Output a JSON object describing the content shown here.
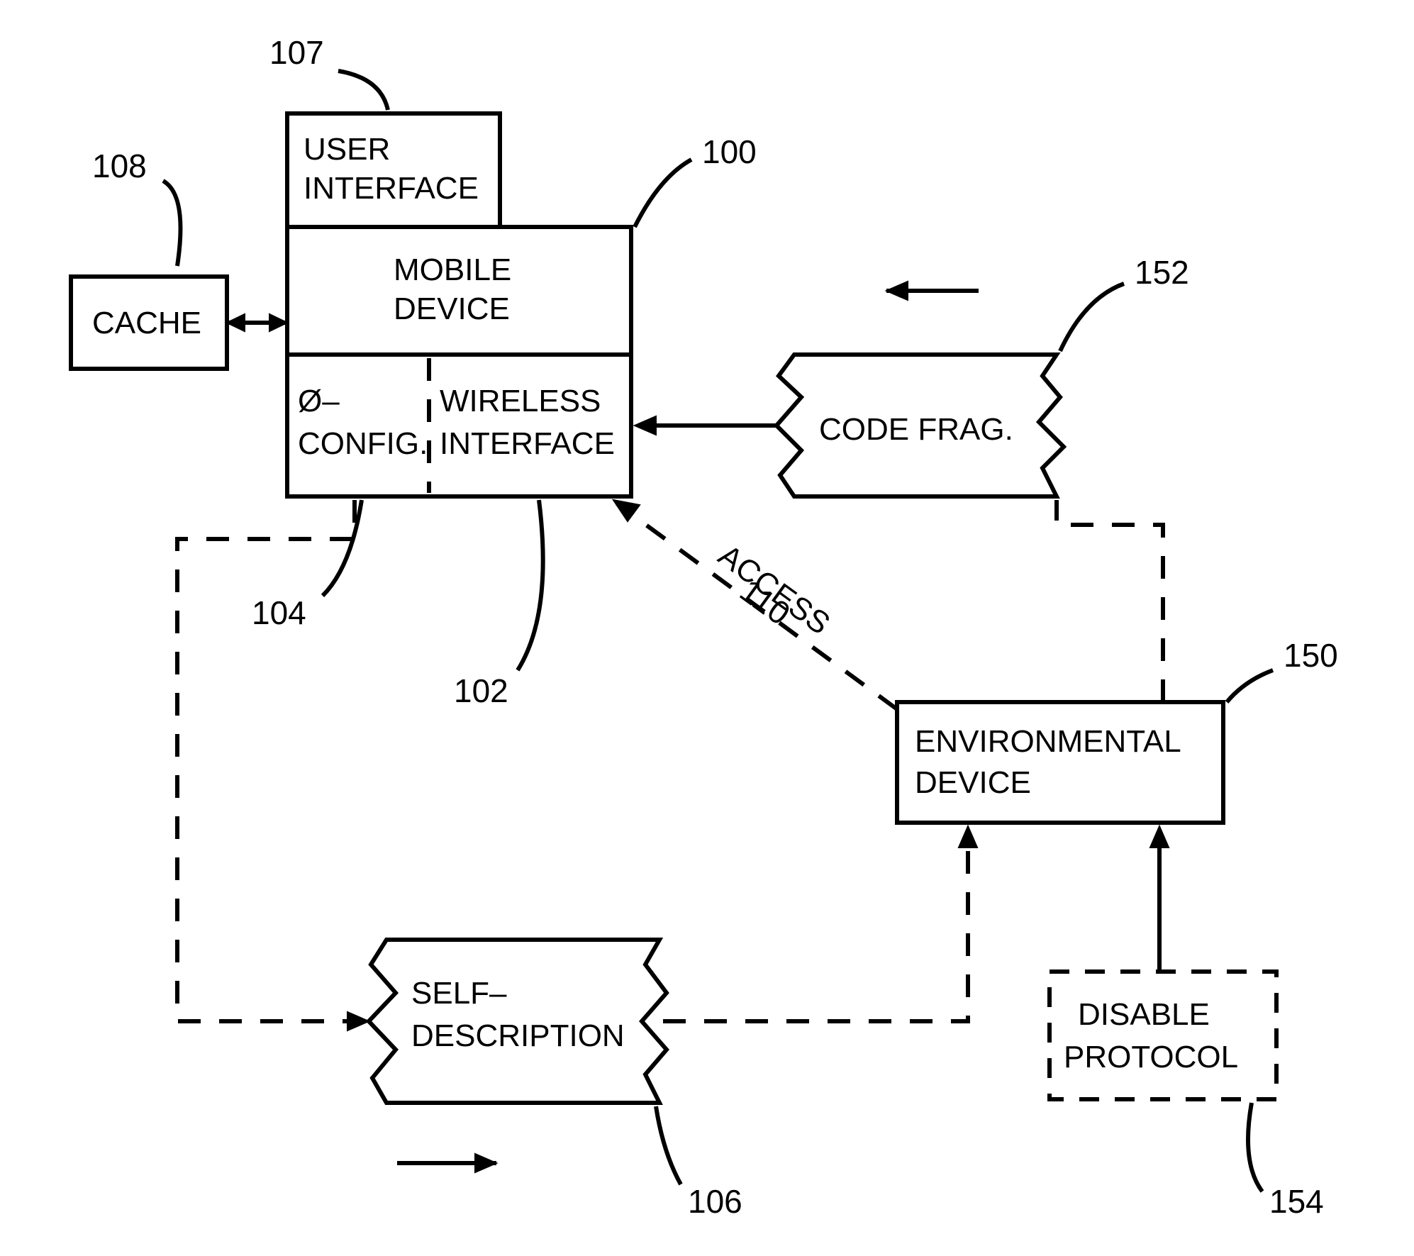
{
  "blocks": {
    "cache": {
      "label": "CACHE",
      "ref": "108"
    },
    "user_interface": {
      "line1": "USER",
      "line2": "INTERFACE",
      "ref": "107"
    },
    "mobile_device": {
      "line1": "MOBILE",
      "line2": "DEVICE",
      "ref": "100"
    },
    "zero_config": {
      "line1": "Ø–",
      "line2": "CONFIG.",
      "ref": "104"
    },
    "wireless_interface": {
      "line1": "WIRELESS",
      "line2": "INTERFACE",
      "ref": "102"
    },
    "code_frag": {
      "label": "CODE FRAG.",
      "ref": "152"
    },
    "env_device": {
      "line1": "ENVIRONMENTAL",
      "line2": "DEVICE",
      "ref": "150"
    },
    "self_descr": {
      "line1": "SELF–",
      "line2": "DESCRIPTION",
      "ref": "106"
    },
    "disable_proto": {
      "line1": "DISABLE",
      "line2": "PROTOCOL",
      "ref": "154"
    },
    "access": {
      "label": "ACCESS",
      "ref": "110"
    }
  }
}
